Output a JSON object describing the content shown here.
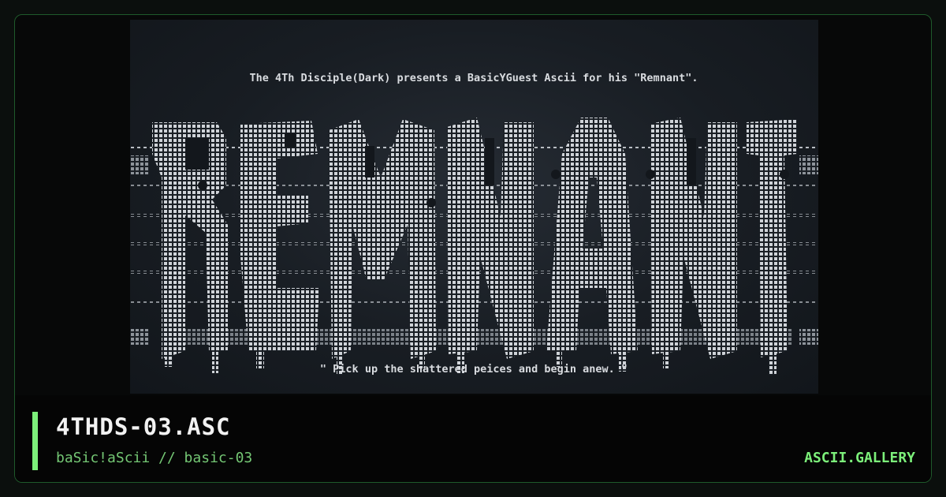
{
  "preview": {
    "header_line": "The 4Th Disciple(Dark) presents a BasicYGuest Ascii for his \"Remnant\".",
    "logo_word": "REMNANT",
    "footer_line": "\" Pick up the shattered peices and begin anew. \""
  },
  "footer": {
    "title": "4THDS-03.ASC",
    "subtitle": "baSic!aScii // basic-03",
    "brand": "ASCII.GALLERY"
  },
  "colors": {
    "accent": "#7cf07a",
    "subtitle": "#74c774",
    "border": "#1f5a2b",
    "ascii_text": "#d9dce0"
  }
}
